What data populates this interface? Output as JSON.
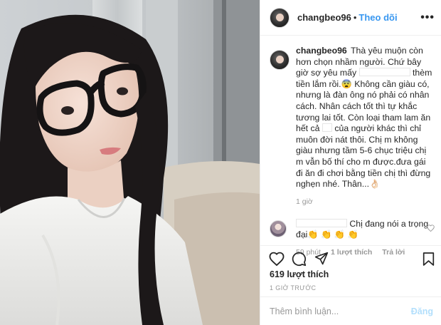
{
  "post": {
    "username": "changbeo96",
    "follow_label": "Theo dõi",
    "separator": "•",
    "more_label": "•••",
    "caption": {
      "username": "changbeo96",
      "part1": "Thà yêu muộn còn hơn chọn nhầm người. Chứ bây giờ sợ yêu mấy",
      "part2": "thèm tiền lắm rồi.😨 Không cần giàu có, nhưng là đàn ông nó phải có nhân cách. Nhân cách tốt thì tự khắc tương lai tốt. Còn loại tham lam ăn hết cả",
      "part3": "của người khác thì chỉ muôn đời nát thôi. Chị m không giàu nhưng tầm 5-6 chục triệu chị m vẫn bố thí cho m được.đưa gái đi ăn đi chơi bằng tiền chị thì đừng nghẹn nhé. Thân...👌🏻",
      "time": "1 giờ"
    },
    "reply": {
      "text": "Chị đang nói a trọng đại👏 👏 👏 👏",
      "time": "59 phút",
      "likes": "1 lượt thích",
      "reply_label": "Trả lời"
    },
    "likes_count": "619 lượt thích",
    "timestamp": "1 GIỜ TRƯỚC",
    "comment_placeholder": "Thêm bình luận...",
    "post_button": "Đăng"
  },
  "colors": {
    "link_blue": "#3897f0",
    "post_disabled": "#b2dffc",
    "meta_gray": "#999999"
  },
  "icons": [
    "more-options-icon",
    "heart-icon",
    "comment-icon",
    "share-icon",
    "bookmark-icon",
    "small-heart-icon"
  ]
}
